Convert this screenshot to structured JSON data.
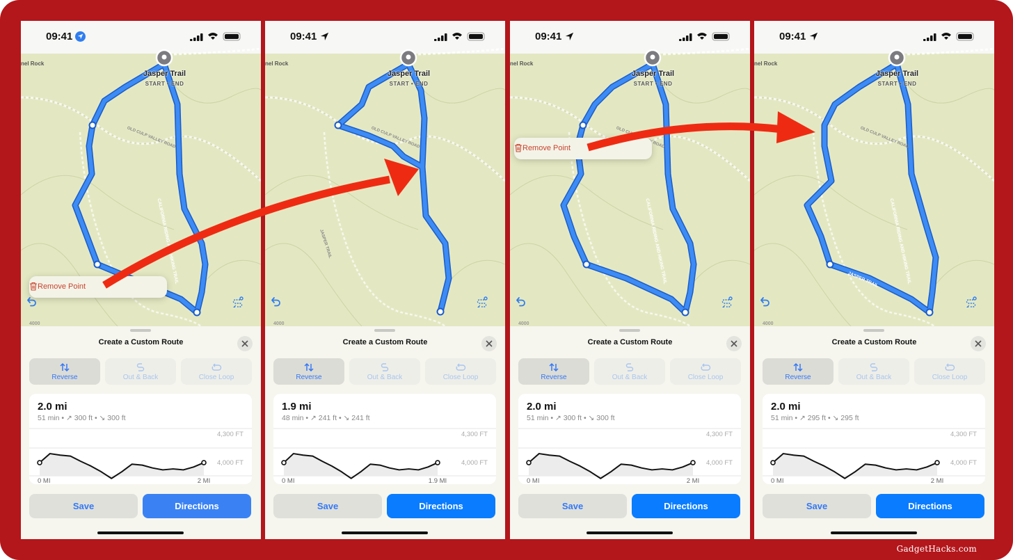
{
  "watermark": "GadgetHacks.com",
  "colors": {
    "frame": "#b3161b",
    "route": "#2f7df0",
    "accent": "#3478f6",
    "remove": "#c9442d",
    "arrow": "#ee2b12"
  },
  "panels": [
    {
      "status": {
        "time": "09:41",
        "location_icon": "location-filled-icon"
      },
      "map": {
        "place_label": "nel Rock",
        "trail_title": "Jasper Trail",
        "trail_subtitle": "START • END",
        "road_label": "OLD CULP VALLEY ROAD",
        "trail_label": "CALIFORNIA RIDING AND HIKING TRAIL",
        "contour_label": "4000",
        "popup": "Remove Point"
      },
      "sheet": {
        "title": "Create a Custom Route",
        "options": [
          "Reverse",
          "Out & Back",
          "Close Loop"
        ],
        "distance": "2.0 mi",
        "time": "51 min",
        "ascent": "300 ft",
        "descent": "300 ft",
        "y_top": "4,300 FT",
        "y_bottom": "4,000 FT",
        "x_start": "0 MI",
        "x_end": "2 MI",
        "save": "Save",
        "directions": "Directions"
      }
    },
    {
      "status": {
        "time": "09:41",
        "location_icon": "location-arrow-icon"
      },
      "map": {
        "place_label": "nel Rock",
        "trail_title": "Jasper Trail",
        "trail_subtitle": "START • END",
        "road_label": "OLD CULP VALLEY ROAD",
        "side_trail_label": "JASPER TRAIL",
        "contour_label": "4000"
      },
      "sheet": {
        "title": "Create a Custom Route",
        "options": [
          "Reverse",
          "Out & Back",
          "Close Loop"
        ],
        "distance": "1.9 mi",
        "time": "48 min",
        "ascent": "241 ft",
        "descent": "241 ft",
        "y_top": "4,300 FT",
        "y_bottom": "4,000 FT",
        "x_start": "0 MI",
        "x_end": "1.9 MI",
        "save": "Save",
        "directions": "Directions"
      }
    },
    {
      "status": {
        "time": "09:41",
        "location_icon": "location-arrow-icon"
      },
      "map": {
        "place_label": "nel Rock",
        "trail_title": "Jasper Trail",
        "trail_subtitle": "START • END",
        "road_label": "OLD CULP VALLEY ROAD",
        "trail_label": "CALIFORNIA RIDING AND HIKING TRAIL",
        "contour_label": "4000",
        "popup": "Remove Point"
      },
      "sheet": {
        "title": "Create a Custom Route",
        "options": [
          "Reverse",
          "Out & Back",
          "Close Loop"
        ],
        "distance": "2.0 mi",
        "time": "51 min",
        "ascent": "300 ft",
        "descent": "300 ft",
        "y_top": "4,300 FT",
        "y_bottom": "4,000 FT",
        "x_start": "0 MI",
        "x_end": "2 MI",
        "save": "Save",
        "directions": "Directions"
      }
    },
    {
      "status": {
        "time": "09:41",
        "location_icon": "location-arrow-icon"
      },
      "map": {
        "place_label": "nel Rock",
        "trail_title": "Jasper Trail",
        "trail_subtitle": "START • END",
        "road_label": "OLD CULP VALLEY ROAD",
        "trail_label": "CALIFORNIA RIDING AND HIKING TRAIL",
        "route_label": "JASPER TRAIL",
        "contour_label": "4000"
      },
      "sheet": {
        "title": "Create a Custom Route",
        "options": [
          "Reverse",
          "Out & Back",
          "Close Loop"
        ],
        "distance": "2.0 mi",
        "time": "51 min",
        "ascent": "295 ft",
        "descent": "295 ft",
        "y_top": "4,300 FT",
        "y_bottom": "4,000 FT",
        "x_start": "0 MI",
        "x_end": "2 MI",
        "save": "Save",
        "directions": "Directions"
      }
    }
  ],
  "elevation_profile": {
    "elevation_ft": [
      4146,
      4241,
      4225,
      4215,
      4160,
      4110,
      4050,
      3980,
      4050,
      4130,
      4120,
      4090,
      4070,
      4080,
      4070,
      4100,
      4146
    ]
  }
}
